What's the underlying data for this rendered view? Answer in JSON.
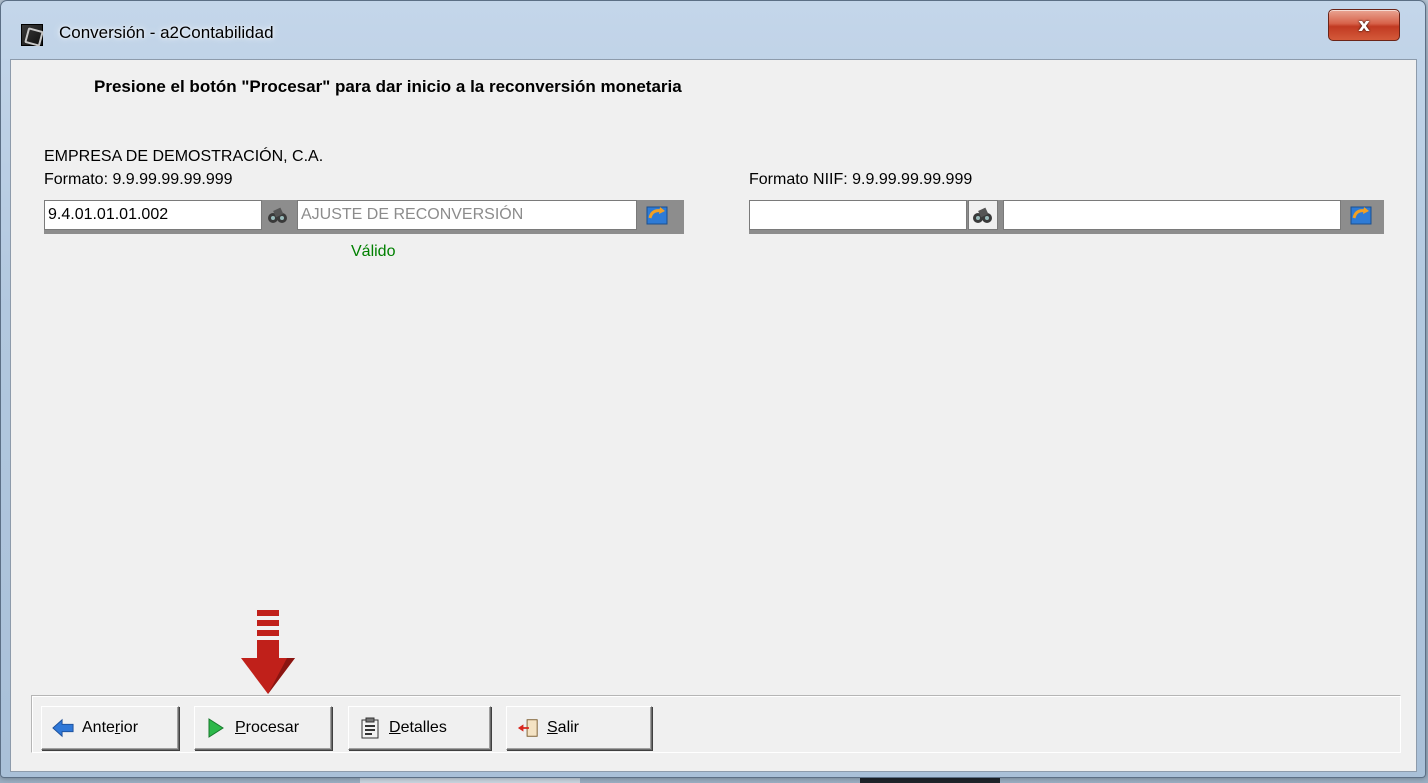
{
  "window": {
    "title": "Conversión - a2Contabilidad",
    "close_label": "x"
  },
  "main": {
    "instruction": "Presione el botón \"Procesar\" para dar inicio a la reconversión monetaria",
    "company": "EMPRESA DE DEMOSTRACIÓN, C.A.",
    "left": {
      "format_label": "Formato: 9.9.99.99.99.999",
      "account_code": "9.4.01.01.01.002",
      "account_name": "AJUSTE DE RECONVERSIÓN",
      "status": "Válido"
    },
    "right": {
      "format_label": "Formato NIIF: 9.9.99.99.99.999",
      "account_code": "",
      "account_name": ""
    }
  },
  "buttons": {
    "anterior": {
      "pre": "Ante",
      "hot": "r",
      "post": "ior"
    },
    "procesar": {
      "pre": "",
      "hot": "P",
      "post": "rocesar"
    },
    "detalles": {
      "pre": "",
      "hot": "D",
      "post": "etalles"
    },
    "salir": {
      "pre": "",
      "hot": "S",
      "post": "alir"
    }
  },
  "colors": {
    "valid": "#008000",
    "arrow": "#c0201a",
    "close": "#c13a22"
  }
}
